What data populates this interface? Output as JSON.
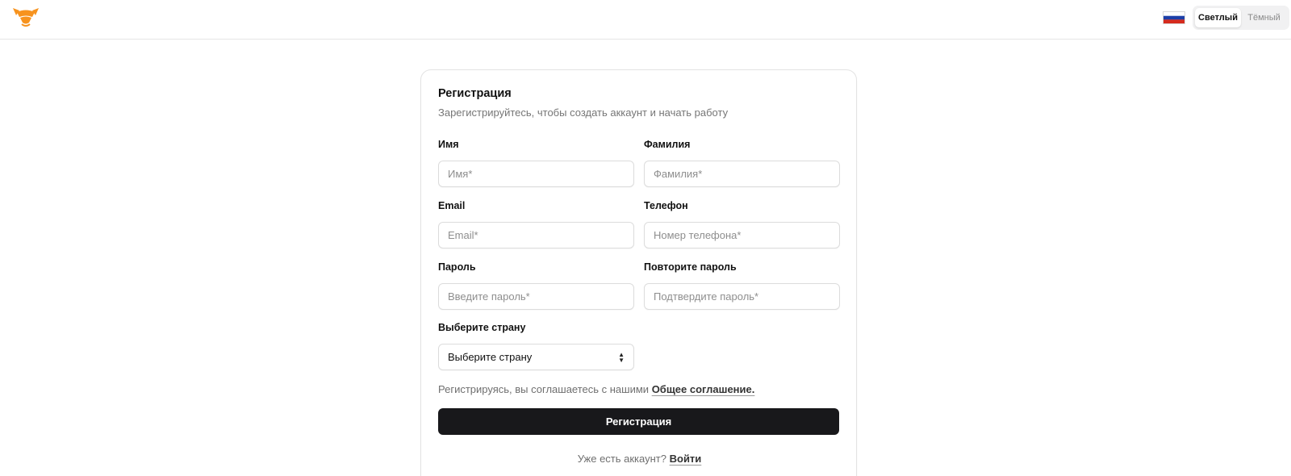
{
  "header": {
    "logo_icon": "fox-logo-icon",
    "flag_icon": "russia-flag-icon",
    "theme": {
      "light": "Светлый",
      "dark": "Тёмный",
      "selected": "light"
    }
  },
  "form": {
    "title": "Регистрация",
    "subtitle": "Зарегистрируйтесь, чтобы создать аккаунт и начать работу",
    "first_name": {
      "label": "Имя",
      "placeholder": "Имя*"
    },
    "last_name": {
      "label": "Фамилия",
      "placeholder": "Фамилия*"
    },
    "email": {
      "label": "Email",
      "placeholder": "Email*"
    },
    "phone": {
      "label": "Телефон",
      "placeholder": "Номер телефона*"
    },
    "password": {
      "label": "Пароль",
      "placeholder": "Введите пароль*"
    },
    "password_confirm": {
      "label": "Повторите пароль",
      "placeholder": "Подтвердите пароль*"
    },
    "country": {
      "label": "Выберите страну",
      "value": "Выберите страну"
    },
    "agreement_text": "Регистрируясь, вы соглашаетесь с нашими",
    "agreement_link": "Общее соглашение.",
    "submit_label": "Регистрация",
    "login_text": "Уже есть аккаунт?",
    "login_link": "Войти"
  },
  "colors": {
    "accent": "#f7931e",
    "button_bg": "#18181b"
  }
}
